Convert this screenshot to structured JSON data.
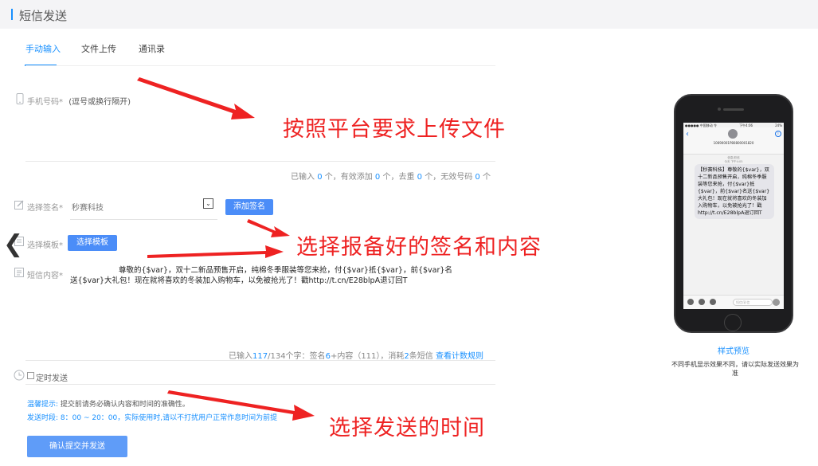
{
  "page_title": "短信发送",
  "tabs": [
    {
      "label": "手动输入"
    },
    {
      "label": "文件上传"
    },
    {
      "label": "通讯录"
    }
  ],
  "phone_field": {
    "label": "手机号码",
    "star": "*",
    "hint": "(逗号或换行隔开)"
  },
  "phone_stats": {
    "p1": "已输入 ",
    "v1": "0",
    "p2": " 个，有效添加 ",
    "v2": "0",
    "p3": " 个，去重 ",
    "v3": "0",
    "p4": " 个，无效号码 ",
    "v4": "0",
    "p5": " 个"
  },
  "signature": {
    "label": "选择签名",
    "star": "*",
    "value": "秒赛科技",
    "add_button": "添加签名"
  },
  "template": {
    "label": "选择模板",
    "star": "*",
    "button": "选择模板"
  },
  "content": {
    "label": "短信内容",
    "star": "*",
    "line1": "尊敬的{$var}，双十二新品预售开启，纯棉冬季服装等您来抢，付{$var}抵{$var}，前{$var}名",
    "line2": "送{$var}大礼包！现在就将喜欢的冬装加入购物车，以免被抢光了！戳http://t.cn/E28blpA退订回T"
  },
  "content_stats": {
    "p1": "已输入",
    "v1": "117",
    "p2": "/134个字：签名",
    "v2": "6",
    "p3": "+内容（111），消耗",
    "v3": "2",
    "p4": "条短信",
    "link": "查看计数规则"
  },
  "schedule": {
    "label": "定时发送"
  },
  "tips": {
    "label1": "温馨提示:",
    "text1": " 提交前请务必确认内容和时间的准确性。",
    "label2": "发送时段:",
    "text2": " 8：00 ~ 20：00，实际使用时,请以不打扰用户正常作息时间为前提"
  },
  "submit_button": "确认提交并发送",
  "annotations": {
    "a1": "按照平台要求上传文件",
    "a2": "选择报备好的签名和内容",
    "a3": "选择发送的时间"
  },
  "preview": {
    "status_left": "●●●●● 中国移动 令",
    "status_center": "下午4:06",
    "status_right": "24%",
    "sender": "10690001P80800001820",
    "date_line1": "信息/彩信",
    "date_line2": "今天 下午4:05",
    "message": "【秒赛科技】尊敬的{$var}，双十二新品预售开启，纯棉冬季服装等您来抢，付{$var}抵{$var}，前{$var}名送{$var}大礼包！现在就将喜欢的冬装加入购物车，以免被抢光了！戳http://t.cn/E28blpA退订回T",
    "input_placeholder": "短信/彩信",
    "link": "样式预览",
    "note": "不同手机显示效果不同，请以实际发送效果为准"
  },
  "colors": {
    "accent": "#1890ff",
    "button": "#4b8df8",
    "annotation": "#ee2222"
  }
}
